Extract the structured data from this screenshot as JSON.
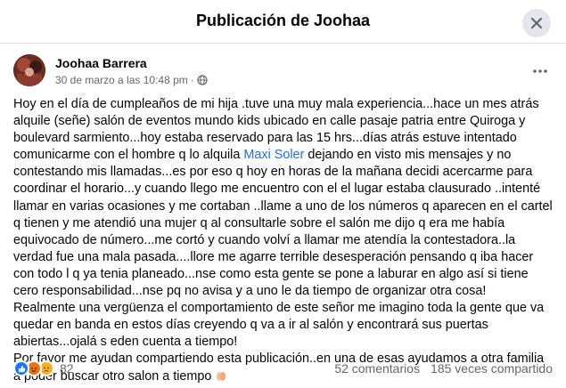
{
  "dialog": {
    "title": "Publicación de Joohaa"
  },
  "post": {
    "author": "Joohaa Barrera",
    "date": "30 de marzo a las 10:48 pm",
    "separator": "·",
    "body": {
      "p1_before_mention": "Hoy en el día de cumpleaños de mi hija .tuve una muy mala experiencia...hace un mes atrás alquile (señe) salón de eventos mundo kids ubicado en calle pasaje patria entre Quiroga y boulevard sarmiento...hoy estaba reservado para las 15 hrs...días atrás estuve intentado comunicarme con el hombre q lo alquila ",
      "mention": "Maxi Soler",
      "p1_after_mention": " dejando en visto mis mensajes y no contestando mis llamadas...es por eso q hoy en horas de la mañana decidi acercarme para coordinar el horario...y cuando llego me encuentro con el el lugar estaba clausurado ..intenté llamar en varias ocasiones y me cortaban ..llame a uno de los números q aparecen en el cartel q tienen y me atendió una mujer q al consultarle sobre el salón me dijo q era me había equivocado de número...me cortó y cuando volví a llamar me atendía la contestadora..la verdad fue una mala pasada....llore me agarre terrible desesperación pensando q iba hacer con todo l q ya tenia planeado...nse como esta gente se pone a laburar en algo así si tiene cero responsabilidad...nse pq no avisa y a uno le da tiempo de organizar otra cosa!",
      "p2": "Realmente una vergüenza el comportamiento de este señor me imagino toda la gente que va quedar en banda en estos días creyendo q va a ir al salón y encontrará sus puertas abiertas...ojalá s eden cuenta a tiempo!",
      "p3": "Por favor me ayudan compartiendo esta publicación..en una de esas ayudamos a otra familia a poder buscar otro salon a tiempo"
    }
  },
  "footer": {
    "reaction_count": "82",
    "comments": "52 comentarios",
    "shares": "185 veces compartido"
  },
  "icons": {
    "close": "close-icon",
    "more": "more-horizontal-icon",
    "audience": "globe-icon",
    "reactions": [
      "like-icon",
      "angry-icon",
      "sad-icon"
    ],
    "emoji": "folded-hands-emoji"
  },
  "colors": {
    "mention": "#216fdb",
    "like": "#1877f2",
    "angry": "#e9710f",
    "sad": "#f7b125",
    "secondary_text": "#65676b"
  }
}
